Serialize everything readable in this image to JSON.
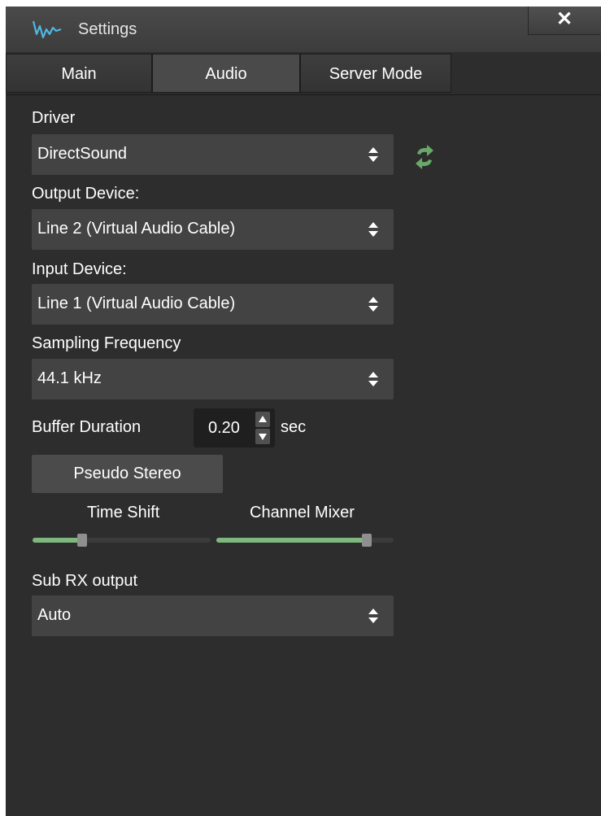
{
  "window": {
    "title": "Settings",
    "close_label": "✕"
  },
  "tabs": [
    {
      "label": "Main",
      "active": false
    },
    {
      "label": "Audio",
      "active": true
    },
    {
      "label": "Server Mode",
      "active": false
    }
  ],
  "driver": {
    "label": "Driver",
    "value": "DirectSound"
  },
  "output_device": {
    "label": "Output Device:",
    "value": "Line 2 (Virtual Audio Cable)"
  },
  "input_device": {
    "label": "Input Device:",
    "value": "Line 1 (Virtual Audio Cable)"
  },
  "sampling": {
    "label": "Sampling Frequency",
    "value": "44.1 kHz"
  },
  "buffer": {
    "label": "Buffer Duration",
    "value": "0.20",
    "unit": "sec"
  },
  "pseudo_stereo": {
    "label": "Pseudo Stereo"
  },
  "sliders": {
    "time_shift": {
      "label": "Time Shift",
      "level_percent": 28
    },
    "channel_mixer": {
      "label": "Channel Mixer",
      "level_percent": 85
    }
  },
  "sub_rx": {
    "label": "Sub RX output",
    "value": "Auto"
  },
  "colors": {
    "background": "#2d2d2d",
    "slider_fill": "#7fb87f",
    "accent_icon": "#6aa86a"
  },
  "icons": {
    "app": "waveform-icon",
    "refresh": "refresh-icon",
    "select": "updown-arrows-icon"
  }
}
